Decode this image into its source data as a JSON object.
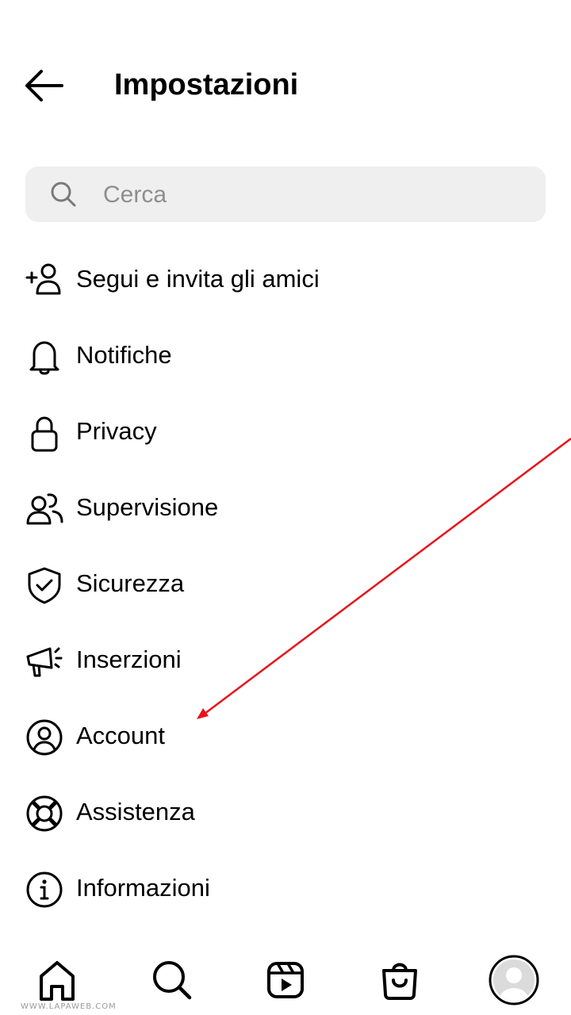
{
  "header": {
    "title": "Impostazioni",
    "back_icon": "arrow-left-icon"
  },
  "search": {
    "placeholder": "Cerca",
    "value": "",
    "icon": "search-icon"
  },
  "menu": {
    "items": [
      {
        "label": "Segui e invita gli amici",
        "icon": "add-person-icon"
      },
      {
        "label": "Notifiche",
        "icon": "bell-icon"
      },
      {
        "label": "Privacy",
        "icon": "lock-icon"
      },
      {
        "label": "Supervisione",
        "icon": "people-icon"
      },
      {
        "label": "Sicurezza",
        "icon": "shield-check-icon"
      },
      {
        "label": "Inserzioni",
        "icon": "megaphone-icon"
      },
      {
        "label": "Account",
        "icon": "account-circle-icon"
      },
      {
        "label": "Assistenza",
        "icon": "lifebuoy-icon"
      },
      {
        "label": "Informazioni",
        "icon": "info-icon"
      }
    ]
  },
  "annotation": {
    "color": "#e8141b",
    "points_to": "Account"
  },
  "bottom_nav": {
    "items": [
      {
        "icon": "home-icon"
      },
      {
        "icon": "search-icon"
      },
      {
        "icon": "reels-icon"
      },
      {
        "icon": "shop-bag-icon"
      },
      {
        "icon": "profile-avatar-icon"
      }
    ]
  },
  "watermark": "WWW.LAPAWEB.COM"
}
